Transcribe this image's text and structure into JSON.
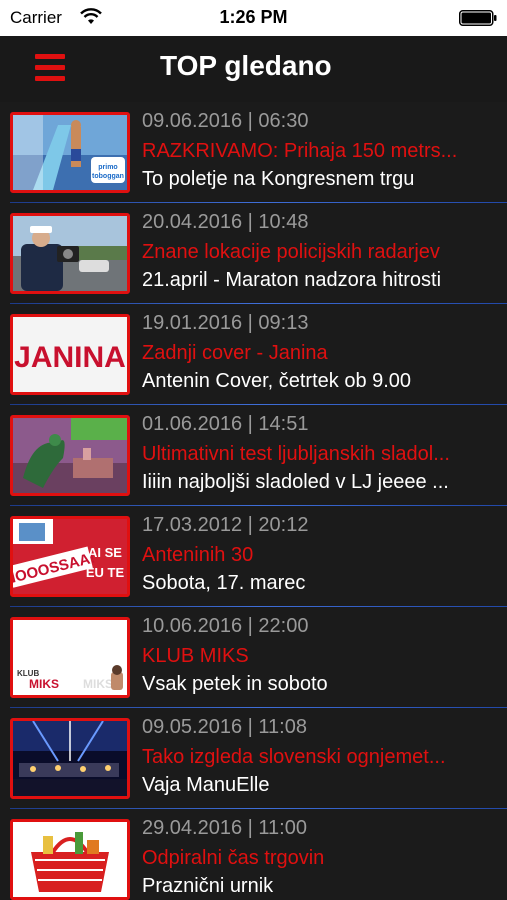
{
  "status_bar": {
    "carrier": "Carrier",
    "time": "1:26 PM",
    "wifi_icon": "wifi-icon",
    "battery_icon": "battery-icon"
  },
  "nav": {
    "title": "TOP gledano",
    "menu_icon": "hamburger-menu-icon"
  },
  "colors": {
    "accent": "#e01010",
    "background": "#1b1b1b",
    "date_text": "#9a9a9a",
    "separator": "#3f6ed8"
  },
  "items": [
    {
      "date": "09.06.2016 | 06:30",
      "title": "RAZKRIVAMO: Prihaja 150 metrs...",
      "subtitle": "To poletje na Kongresnem trgu",
      "thumb_text": ""
    },
    {
      "date": "20.04.2016 | 10:48",
      "title": "Znane lokacije policijskih radarjev",
      "subtitle": "21.april - Maraton nadzora hitrosti",
      "thumb_text": ""
    },
    {
      "date": "19.01.2016 | 09:13",
      "title": "Zadnji cover - Janina",
      "subtitle": "Antenin Cover, četrtek ob 9.00",
      "thumb_text": "JANINA"
    },
    {
      "date": "01.06.2016 | 14:51",
      "title": "Ultimativni test ljubljanskih sladol...",
      "subtitle": "Iiiin najboljši sladoled v LJ jeeee ...",
      "thumb_text": ""
    },
    {
      "date": "17.03.2012 | 20:12",
      "title": "Anteninih 30",
      "subtitle": "Sobota, 17. marec",
      "thumb_text": "NOOOSSAA! AI SE EU TE"
    },
    {
      "date": "10.06.2016 | 22:00",
      "title": "KLUB MIKS",
      "subtitle": "Vsak petek in soboto",
      "thumb_text": "KLUB MIKS"
    },
    {
      "date": "09.05.2016 | 11:08",
      "title": "Tako izgleda slovenski ognjemet...",
      "subtitle": "Vaja ManuElle",
      "thumb_text": ""
    },
    {
      "date": "29.04.2016 | 11:00",
      "title": "Odpiralni čas trgovin",
      "subtitle": "Praznični urnik",
      "thumb_text": ""
    }
  ]
}
